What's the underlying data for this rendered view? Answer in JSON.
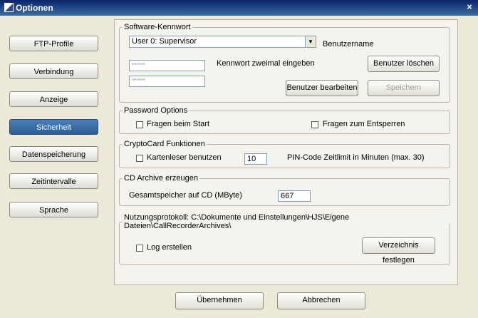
{
  "window": {
    "title": "Optionen",
    "close_glyph": "×"
  },
  "nav": {
    "items": [
      {
        "label": "FTP-Profile"
      },
      {
        "label": "Verbindung"
      },
      {
        "label": "Anzeige"
      },
      {
        "label": "Sicherheit",
        "active": true
      },
      {
        "label": "Datenspeicherung"
      },
      {
        "label": "Zeitintervalle"
      },
      {
        "label": "Sprache"
      }
    ]
  },
  "software_password": {
    "legend": "Software-Kennwort",
    "user_select": "User 0: Supervisor",
    "username_label": "Benutzername",
    "password1": "******",
    "password2": "******",
    "enter_twice_label": "Kennwort zweimal eingeben",
    "delete_user_button": "Benutzer löschen",
    "edit_user_button": "Benutzer bearbeiten",
    "save_button": "Speichern"
  },
  "password_options": {
    "legend": "Password Options",
    "ask_on_start": "Fragen beim Start",
    "ask_on_unlock": "Fragen zum Entsperren"
  },
  "cryptocard": {
    "legend": "CryptoCard Funktionen",
    "use_reader": "Kartenleser benutzen",
    "pin_timeout_value": "10",
    "pin_timeout_label": "PIN-Code Zeitlimit in Minuten (max. 30)"
  },
  "cd_archive": {
    "legend": "CD Archive erzeugen",
    "total_label": "Gesamtspeicher auf CD (MByte)",
    "total_value": "667"
  },
  "usage_log": {
    "legend": "Nutzungsprotokoll: C:\\Dokumente und Einstellungen\\HJS\\Eigene Dateien\\CallRecorderArchives\\",
    "create_log": "Log erstellen",
    "set_dir_button": "Verzeichnis festlegen"
  },
  "footer": {
    "apply_button": "Übernehmen",
    "cancel_button": "Abbrechen"
  },
  "icons": {
    "title": "app-icon",
    "close": "close-icon",
    "dropdown": "chevron-down-icon"
  }
}
